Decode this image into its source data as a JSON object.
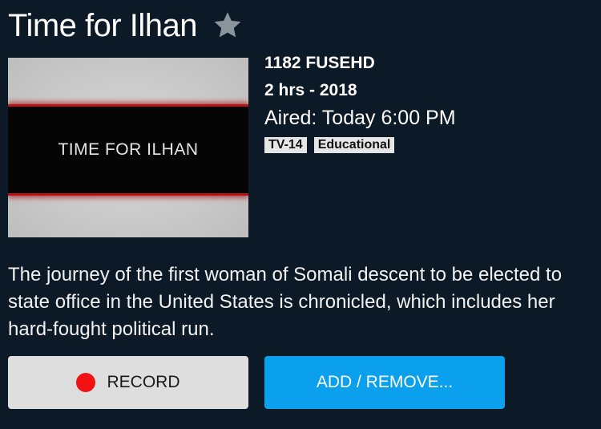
{
  "program": {
    "title": "Time for Ilhan",
    "poster_text": "TIME FOR ILHAN",
    "channel": "1182 FUSEHD",
    "duration_year": "2 hrs - 2018",
    "aired": "Aired: Today 6:00 PM",
    "badges": [
      "TV-14",
      "Educational"
    ],
    "description": "The journey of the first woman of Somali descent to be elected to state office in the United States is chronicled, which includes her hard-fought political run."
  },
  "actions": {
    "record_label": "RECORD",
    "add_remove_label": "ADD / REMOVE..."
  },
  "icons": {
    "favorite": "star-icon",
    "record": "record-dot-icon"
  },
  "colors": {
    "background": "#0b1a26",
    "star": "#8a949c",
    "record_button": "#dedede",
    "record_dot": "#f21212",
    "add_button": "#0aa0ee",
    "badge": "#e6e6e6"
  }
}
